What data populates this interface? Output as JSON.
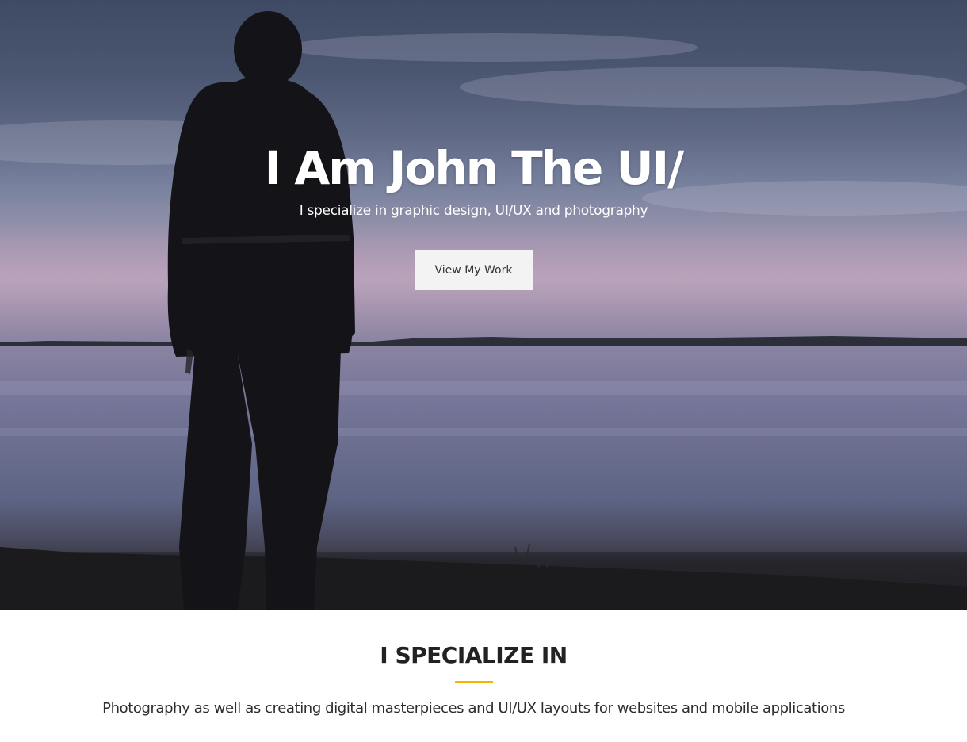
{
  "hero": {
    "title": "I Am John The UI/",
    "subtitle": "I specialize in graphic design, UI/UX and photography",
    "cta_label": "View My Work"
  },
  "specialize": {
    "heading": "I SPECIALIZE IN",
    "description": "Photography as well as creating digital masterpieces and UI/UX layouts for websites and mobile applications",
    "accent_color": "#f5b400"
  }
}
